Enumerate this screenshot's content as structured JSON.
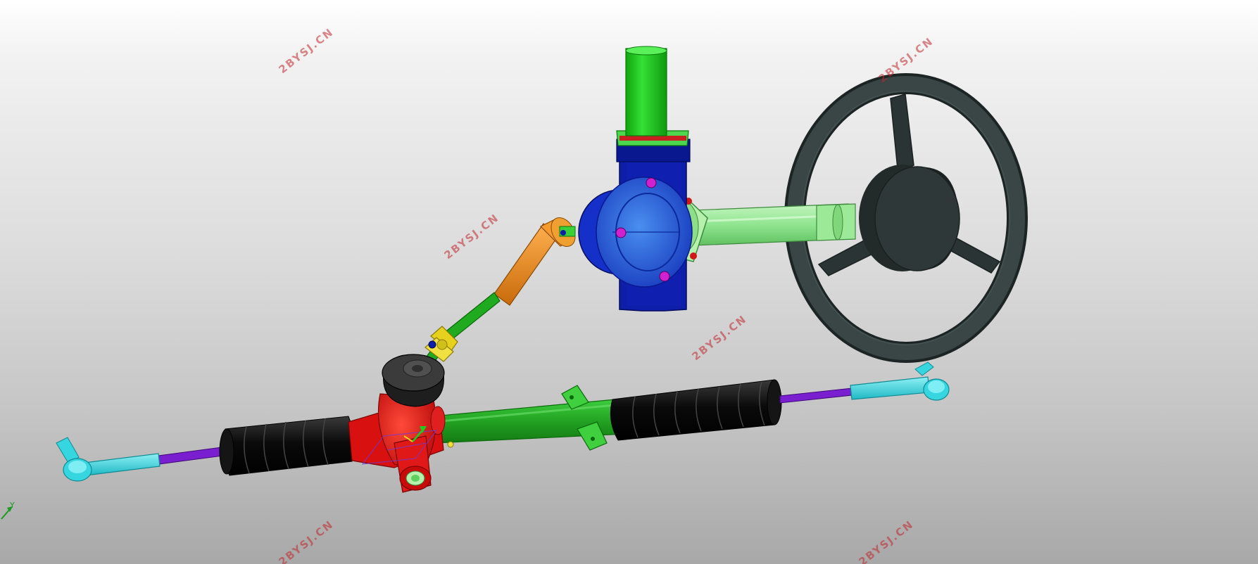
{
  "watermarks": {
    "mark_1": "2BYSJ.CN",
    "mark_2": "2BYSJ.CN",
    "mark_3": "2BYSJ.CN",
    "mark_4": "2BYSJ.CN",
    "mark_5": "2BYSJ.CN",
    "mark_6": "2BYSJ.CN"
  },
  "triad": {
    "y_label": "Y"
  },
  "colors": {
    "watermark": "#c0262c",
    "steering_wheel": "#2b3434",
    "steering_column": "#8fe58f",
    "motor": "#1fcc1f",
    "housing": "#0d1ea8",
    "housing_light": "#2f6ee0",
    "flange": "#a8f0a0",
    "bolt_red": "#d01818",
    "bolt_magenta": "#d020d0",
    "intermediate_shaft": "#f08a1c",
    "lower_shaft": "#1faa1f",
    "u_joint": "#e6d21c",
    "rack_tube": "#23a323",
    "gear_housing": "#e81414",
    "bellows": "#101010",
    "tie_rod": "#7a1fd0",
    "tie_rod_end": "#36d6e0",
    "cap": "#3b3b3b"
  }
}
